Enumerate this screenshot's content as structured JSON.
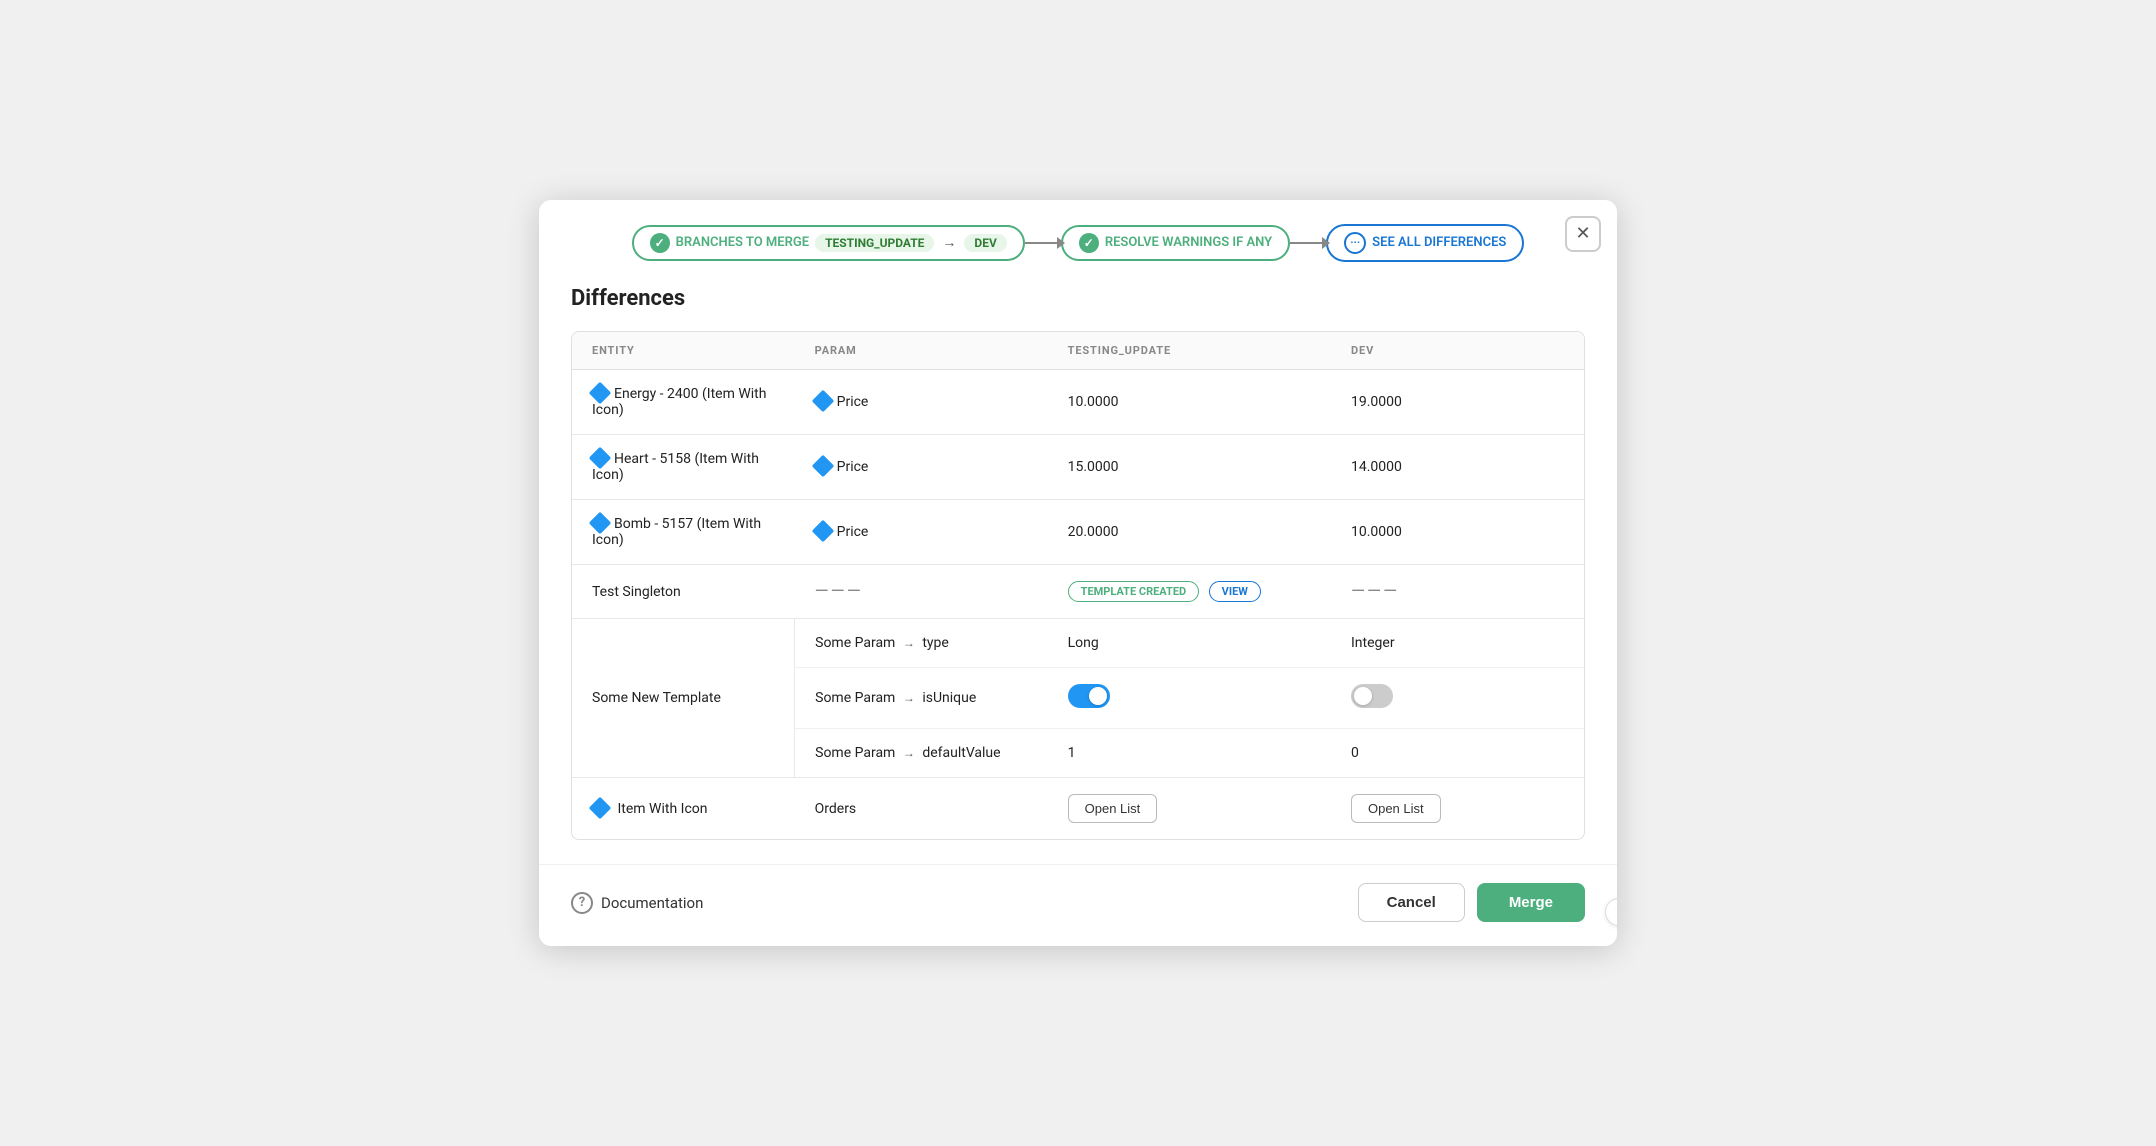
{
  "modal": {
    "close_label": "✕"
  },
  "steps": [
    {
      "id": "branches",
      "type": "completed",
      "label": "BRANCHES TO MERGE",
      "tags": [
        "TESTING_UPDATE",
        "DEV"
      ],
      "arrow_between_tags": "→"
    },
    {
      "id": "resolve",
      "type": "completed",
      "label": "RESOLVE WARNINGS IF ANY"
    },
    {
      "id": "see_diff",
      "type": "active",
      "label": "SEE ALL DIFFERENCES"
    }
  ],
  "section_title": "Differences",
  "table": {
    "columns": [
      "ENTITY",
      "PARAM",
      "TESTING_UPDATE",
      "DEV"
    ],
    "rows": [
      {
        "entity": "Energy - 2400 (Item With Icon)",
        "entity_has_icon": true,
        "param": "Price",
        "param_has_icon": true,
        "testing_value": "10.0000",
        "dev_value": "19.0000",
        "type": "simple"
      },
      {
        "entity": "Heart - 5158 (Item With Icon)",
        "entity_has_icon": true,
        "param": "Price",
        "param_has_icon": true,
        "testing_value": "15.0000",
        "dev_value": "14.0000",
        "type": "simple"
      },
      {
        "entity": "Bomb - 5157 (Item With Icon)",
        "entity_has_icon": true,
        "param": "Price",
        "param_has_icon": true,
        "testing_value": "20.0000",
        "dev_value": "10.0000",
        "type": "simple"
      },
      {
        "entity": "Test Singleton",
        "entity_has_icon": false,
        "param": "———",
        "param_is_dash": true,
        "testing_badge": "TEMPLATE CREATED",
        "testing_has_view": true,
        "dev_value": "———",
        "dev_is_dash": true,
        "type": "badge"
      }
    ],
    "multi_entity": {
      "entity": "Some New Template",
      "sub_rows": [
        {
          "param": "Some Param → type",
          "testing_value": "Long",
          "dev_value": "Integer",
          "type": "text"
        },
        {
          "param": "Some Param → isUnique",
          "testing_toggle": "on",
          "dev_toggle": "off",
          "type": "toggle"
        },
        {
          "param": "Some Param → defaultValue",
          "testing_value": "1",
          "dev_value": "0",
          "type": "text"
        }
      ]
    },
    "icon_row": {
      "entity": "Item With Icon",
      "entity_has_icon": true,
      "param": "Orders",
      "testing_btn": "Open List",
      "dev_btn": "Open List"
    }
  },
  "footer": {
    "doc_label": "Documentation",
    "cancel_label": "Cancel",
    "merge_label": "Merge"
  },
  "labels": {
    "template_created": "TEMPLATE CREATED",
    "view": "VIEW",
    "some_param": "Some Param",
    "arrow": "→",
    "type": "type",
    "is_unique": "isUnique",
    "default_value": "defaultValue",
    "orders": "Orders"
  }
}
